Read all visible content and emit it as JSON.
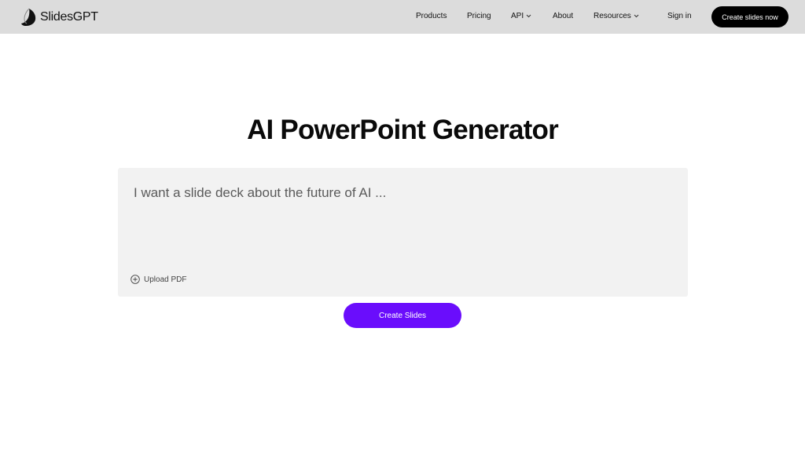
{
  "brand": {
    "name": "SlidesGPT"
  },
  "nav": {
    "items": [
      {
        "label": "Products",
        "dropdown": false
      },
      {
        "label": "Pricing",
        "dropdown": false
      },
      {
        "label": "API",
        "dropdown": true
      },
      {
        "label": "About",
        "dropdown": false
      },
      {
        "label": "Resources",
        "dropdown": true
      }
    ],
    "sign_in": "Sign in",
    "cta": "Create slides now"
  },
  "main": {
    "title": "AI PowerPoint Generator",
    "prompt_placeholder": "I want a slide deck about the future of AI ...",
    "upload_label": "Upload PDF",
    "create_button": "Create Slides"
  },
  "colors": {
    "navbar_bg": "#dcdcdc",
    "accent": "#6a0dfc",
    "cta_bg": "#000000",
    "prompt_bg": "#f2f2f2"
  },
  "icons": {
    "logo": "slidesgpt-logo-icon",
    "dropdown": "chevron-down-icon",
    "upload": "plus-circle-icon"
  }
}
